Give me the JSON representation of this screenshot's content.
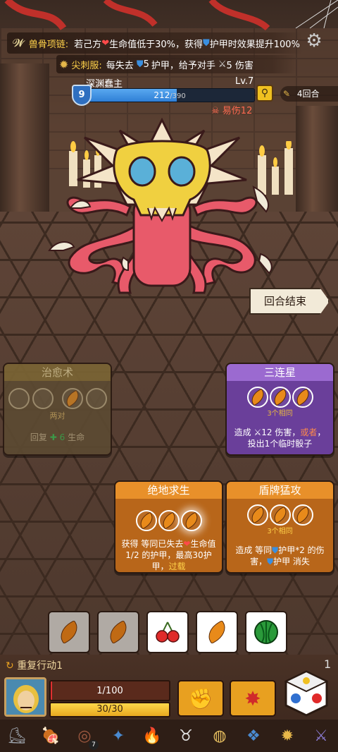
{
  "header": {
    "relic1_name": "兽骨项链:",
    "relic1_text_a": "若己方",
    "relic1_text_b": "生命值低于30%，获得",
    "relic1_text_c": "护甲时效果提升100%",
    "relic2_name": "尖刺服:",
    "relic2_text_a": "每失去",
    "relic2_text_b": "5",
    "relic2_text_c": "护甲，给予对手",
    "relic2_text_d": "5 伤害"
  },
  "enemy": {
    "name": "深渊蠢主",
    "level": "Lv.7",
    "armor": "9",
    "hp_text": "212",
    "hp_max": "/390",
    "hp_fraction": 0.54,
    "status": "易伤12",
    "rounds": "4回合"
  },
  "end_turn": "回合结束",
  "cards": {
    "heal": {
      "title": "治愈术",
      "req": "两对",
      "desc_a": "回复",
      "desc_b": "6",
      "desc_c": "生命"
    },
    "triple": {
      "title": "三连星",
      "req": "3个相同",
      "desc_a": "造成",
      "desc_b": "12 伤害，",
      "desc_c": "或者",
      "desc_d": "，投出1个临时骰子"
    },
    "desperate": {
      "title": "绝地求生",
      "desc_a": "获得 等同已失去",
      "desc_b": "生命值1/2 的护甲，最高30护甲，",
      "desc_c": "过载"
    },
    "shield": {
      "title": "盾牌猛攻",
      "req": "3个相同",
      "desc_a": "造成 等同",
      "desc_b": "护甲*2 的伤害，",
      "desc_c": "护甲 消失"
    }
  },
  "player": {
    "repeat": "重复行动1",
    "hp": "1/100",
    "hp_fraction": 0.01,
    "energy": "30/30",
    "energy_fraction": 1.0,
    "relic_count": "7",
    "side_count": "1"
  },
  "colors": {
    "hp_bar": "#2f7fd6",
    "armor": "#3a8fe0",
    "orange": "#e88a1a",
    "purple": "#7a4fb5",
    "heal_card": "#6b5536"
  }
}
